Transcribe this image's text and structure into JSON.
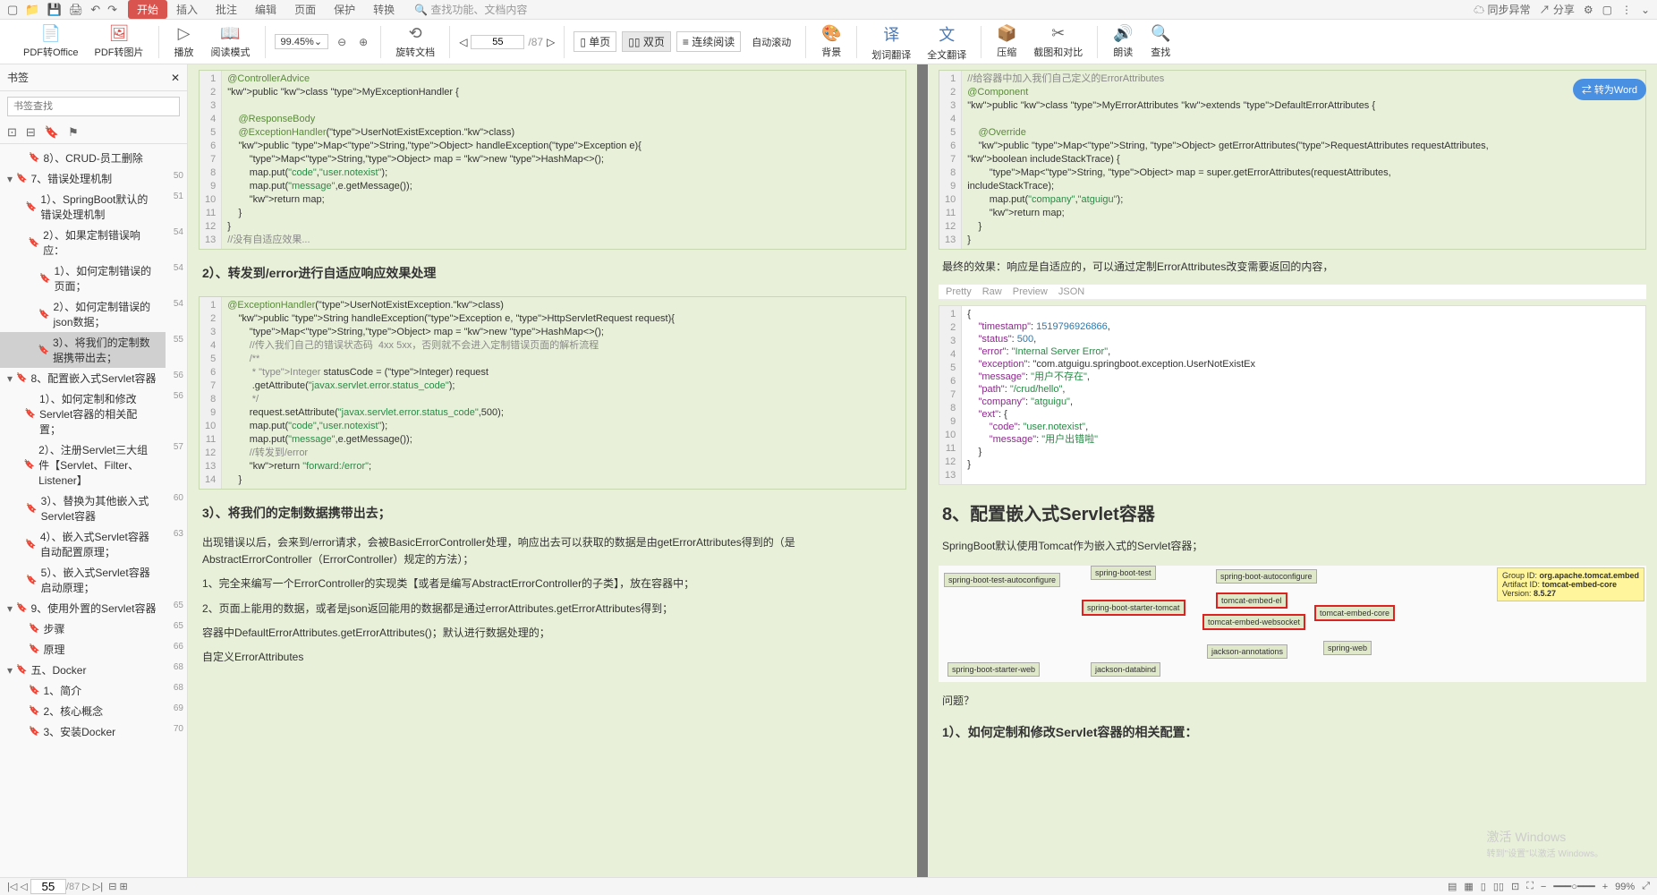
{
  "titlebar": {
    "tabs": [
      "开始",
      "插入",
      "批注",
      "编辑",
      "页面",
      "保护",
      "转换"
    ],
    "active_tab": 0,
    "search_placeholder": "查找功能、文档内容",
    "sync": "同步异常",
    "share": "分享"
  },
  "toolbar": {
    "pdf_office": "PDF转Office",
    "pdf_image": "PDF转图片",
    "play": "播放",
    "read_mode": "阅读模式",
    "zoom": "99.45%",
    "rotate": "旋转文档",
    "page_current": "55",
    "page_total": "/87",
    "single_page": "单页",
    "double_page": "双页",
    "continuous": "连续阅读",
    "auto_scroll": "自动滚动",
    "background": "背景",
    "word_trans": "划词翻译",
    "full_trans": "全文翻译",
    "compress": "压缩",
    "screenshot": "截图和对比",
    "read_aloud": "朗读",
    "find": "查找"
  },
  "sidebar": {
    "title": "书签",
    "search_placeholder": "书签查找",
    "items": [
      {
        "level": 2,
        "label": "8）、CRUD-员工删除",
        "page": ""
      },
      {
        "level": 1,
        "label": "7、错误处理机制",
        "page": "50"
      },
      {
        "level": 2,
        "label": "1）、SpringBoot默认的错误处理机制",
        "page": "51"
      },
      {
        "level": 2,
        "label": "2）、如果定制错误响应：",
        "page": "54"
      },
      {
        "level": 3,
        "label": "1）、如何定制错误的页面；",
        "page": "54"
      },
      {
        "level": 3,
        "label": "2）、如何定制错误的json数据；",
        "page": "54"
      },
      {
        "level": 3,
        "label": "3）、将我们的定制数据携带出去；",
        "page": "55",
        "selected": true
      },
      {
        "level": 1,
        "label": "8、配置嵌入式Servlet容器",
        "page": "56"
      },
      {
        "level": 2,
        "label": "1）、如何定制和修改Servlet容器的相关配置；",
        "page": "56"
      },
      {
        "level": 2,
        "label": "2）、注册Servlet三大组件【Servlet、Filter、Listener】",
        "page": "57"
      },
      {
        "level": 2,
        "label": "3）、替换为其他嵌入式Servlet容器",
        "page": "60"
      },
      {
        "level": 2,
        "label": "4）、嵌入式Servlet容器自动配置原理；",
        "page": "63"
      },
      {
        "level": 2,
        "label": "5）、嵌入式Servlet容器启动原理；",
        "page": ""
      },
      {
        "level": 1,
        "label": "9、使用外置的Servlet容器",
        "page": "65"
      },
      {
        "level": 2,
        "label": "步骤",
        "page": "65"
      },
      {
        "level": 2,
        "label": "原理",
        "page": "66"
      },
      {
        "level": 1,
        "label": "五、Docker",
        "page": "68"
      },
      {
        "level": 2,
        "label": "1、简介",
        "page": "68"
      },
      {
        "level": 2,
        "label": "2、核心概念",
        "page": "69"
      },
      {
        "level": 2,
        "label": "3、安装Docker",
        "page": "70"
      }
    ]
  },
  "convert_btn": "转为Word",
  "left_page": {
    "code1_lines": [
      "@ControllerAdvice",
      "public class MyExceptionHandler {",
      "",
      "    @ResponseBody",
      "    @ExceptionHandler(UserNotExistException.class)",
      "    public Map<String,Object> handleException(Exception e){",
      "        Map<String,Object> map = new HashMap<>();",
      "        map.put(\"code\",\"user.notexist\");",
      "        map.put(\"message\",e.getMessage());",
      "        return map;",
      "    }",
      "}",
      "//没有自适应效果..."
    ],
    "h2_forward": "2）、转发到/error进行自适应响应效果处理",
    "code2_lines": [
      "@ExceptionHandler(UserNotExistException.class)",
      "    public String handleException(Exception e, HttpServletRequest request){",
      "        Map<String,Object> map = new HashMap<>();",
      "        //传入我们自己的错误状态码  4xx 5xx，否则就不会进入定制错误页面的解析流程",
      "        /**",
      "         * Integer statusCode = (Integer) request",
      "         .getAttribute(\"javax.servlet.error.status_code\");",
      "         */",
      "        request.setAttribute(\"javax.servlet.error.status_code\",500);",
      "        map.put(\"code\",\"user.notexist\");",
      "        map.put(\"message\",e.getMessage());",
      "        //转发到/error",
      "        return \"forward:/error\";",
      "    }"
    ],
    "h3_carry": "3）、将我们的定制数据携带出去；",
    "p1": "出现错误以后，会来到/error请求，会被BasicErrorController处理，响应出去可以获取的数据是由getErrorAttributes得到的（是AbstractErrorController（ErrorController）规定的方法）；",
    "p2": "1、完全来编写一个ErrorController的实现类【或者是编写AbstractErrorController的子类】，放在容器中；",
    "p3": "2、页面上能用的数据，或者是json返回能用的数据都是通过errorAttributes.getErrorAttributes得到；",
    "p4": "容器中DefaultErrorAttributes.getErrorAttributes()；默认进行数据处理的；",
    "p5": "自定义ErrorAttributes"
  },
  "right_page": {
    "code3_lines": [
      "//给容器中加入我们自己定义的ErrorAttributes",
      "@Component",
      "public class MyErrorAttributes extends DefaultErrorAttributes {",
      "",
      "    @Override",
      "    public Map<String, Object> getErrorAttributes(RequestAttributes requestAttributes,",
      "boolean includeStackTrace) {",
      "        Map<String, Object> map = super.getErrorAttributes(requestAttributes,",
      "includeStackTrace);",
      "        map.put(\"company\",\"atguigu\");",
      "        return map;",
      "    }",
      "}"
    ],
    "p_final": "最终的效果：响应是自适应的，可以通过定制ErrorAttributes改变需要返回的内容，",
    "json_tabs": [
      "Pretty",
      "Raw",
      "Preview",
      "JSON"
    ],
    "json_lines": [
      "{",
      "    \"timestamp\": 1519796926866,",
      "    \"status\": 500,",
      "    \"error\": \"Internal Server Error\",",
      "    \"exception\": \"com.atguigu.springboot.exception.UserNotExistEx",
      "    \"message\": \"用户不存在\",",
      "    \"path\": \"/crud/hello\",",
      "    \"company\": \"atguigu\",",
      "    \"ext\": {",
      "        \"code\": \"user.notexist\",",
      "        \"message\": \"用户出错啦\"",
      "    }",
      "}"
    ],
    "h8": "8、配置嵌入式Servlet容器",
    "p_tomcat": "SpringBoot默认使用Tomcat作为嵌入式的Servlet容器；",
    "deps": {
      "spring_boot_test_autoconfigure": "spring-boot-test-autoconfigure",
      "spring_boot_test": "spring-boot-test",
      "spring_boot_autoconfigure": "spring-boot-autoconfigure",
      "spring_boot_starter_tomcat": "spring-boot-starter-tomcat",
      "tomcat_embed_el": "tomcat-embed-el",
      "tomcat_embed_websocket": "tomcat-embed-websocket",
      "tomcat_embed_core": "tomcat-embed-core",
      "spring_boot_starter_web": "spring-boot-starter-web",
      "jackson_annotations": "jackson-annotations",
      "jackson_databind": "jackson-databind",
      "spring_web": "spring-web"
    },
    "tooltip": {
      "group": "Group ID: ",
      "group_val": "org.apache.tomcat.embed",
      "artifact": "Artifact ID: ",
      "artifact_val": "tomcat-embed-core",
      "version": "Version: ",
      "version_val": "8.5.27"
    },
    "p_question": "问题？",
    "h_config": "1）、如何定制和修改Servlet容器的相关配置："
  },
  "statusbar": {
    "page": "55",
    "total": "/87",
    "zoom": "99%"
  },
  "watermark": {
    "l1": "激活 Windows",
    "l2": "转到\"设置\"以激活 Windows。"
  }
}
